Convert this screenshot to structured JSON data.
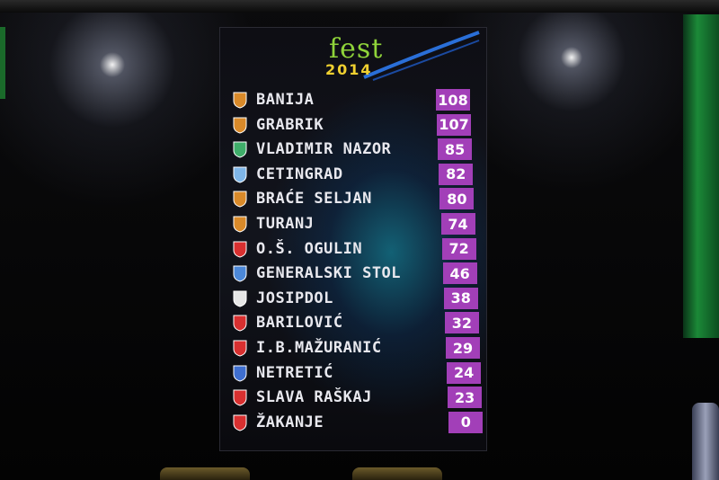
{
  "logo": {
    "word": "fest",
    "year": "2014"
  },
  "scoreboard": [
    {
      "team": "BANIJA",
      "points": "108",
      "crest_color": "#d98a2a"
    },
    {
      "team": "GRABRIK",
      "points": "107",
      "crest_color": "#d98a2a"
    },
    {
      "team": "VLADIMIR NAZOR",
      "points": "85",
      "crest_color": "#3fae6a"
    },
    {
      "team": "CETINGRAD",
      "points": "82",
      "crest_color": "#7fb6e8"
    },
    {
      "team": "BRAĆE SELJAN",
      "points": "80",
      "crest_color": "#d98a2a"
    },
    {
      "team": "TURANJ",
      "points": "74",
      "crest_color": "#d98a2a"
    },
    {
      "team": "O.Š. OGULIN",
      "points": "72",
      "crest_color": "#d83030"
    },
    {
      "team": "GENERALSKI STOL",
      "points": "46",
      "crest_color": "#4c88d8"
    },
    {
      "team": "JOSIPDOL",
      "points": "38",
      "crest_color": "#e6e6e6"
    },
    {
      "team": "BARILOVIĆ",
      "points": "32",
      "crest_color": "#d83030"
    },
    {
      "team": "I.B.MAŽURANIĆ",
      "points": "29",
      "crest_color": "#d83030"
    },
    {
      "team": "NETRETIĆ",
      "points": "24",
      "crest_color": "#3f6fd0"
    },
    {
      "team": "SLAVA RAŠKAJ",
      "points": "23",
      "crest_color": "#d83030"
    },
    {
      "team": "ŽAKANJE",
      "points": "0",
      "crest_color": "#d83030"
    }
  ],
  "colors": {
    "score_box": "#a23fb8",
    "logo_green": "#8fd33a",
    "logo_year": "#f0d030"
  }
}
